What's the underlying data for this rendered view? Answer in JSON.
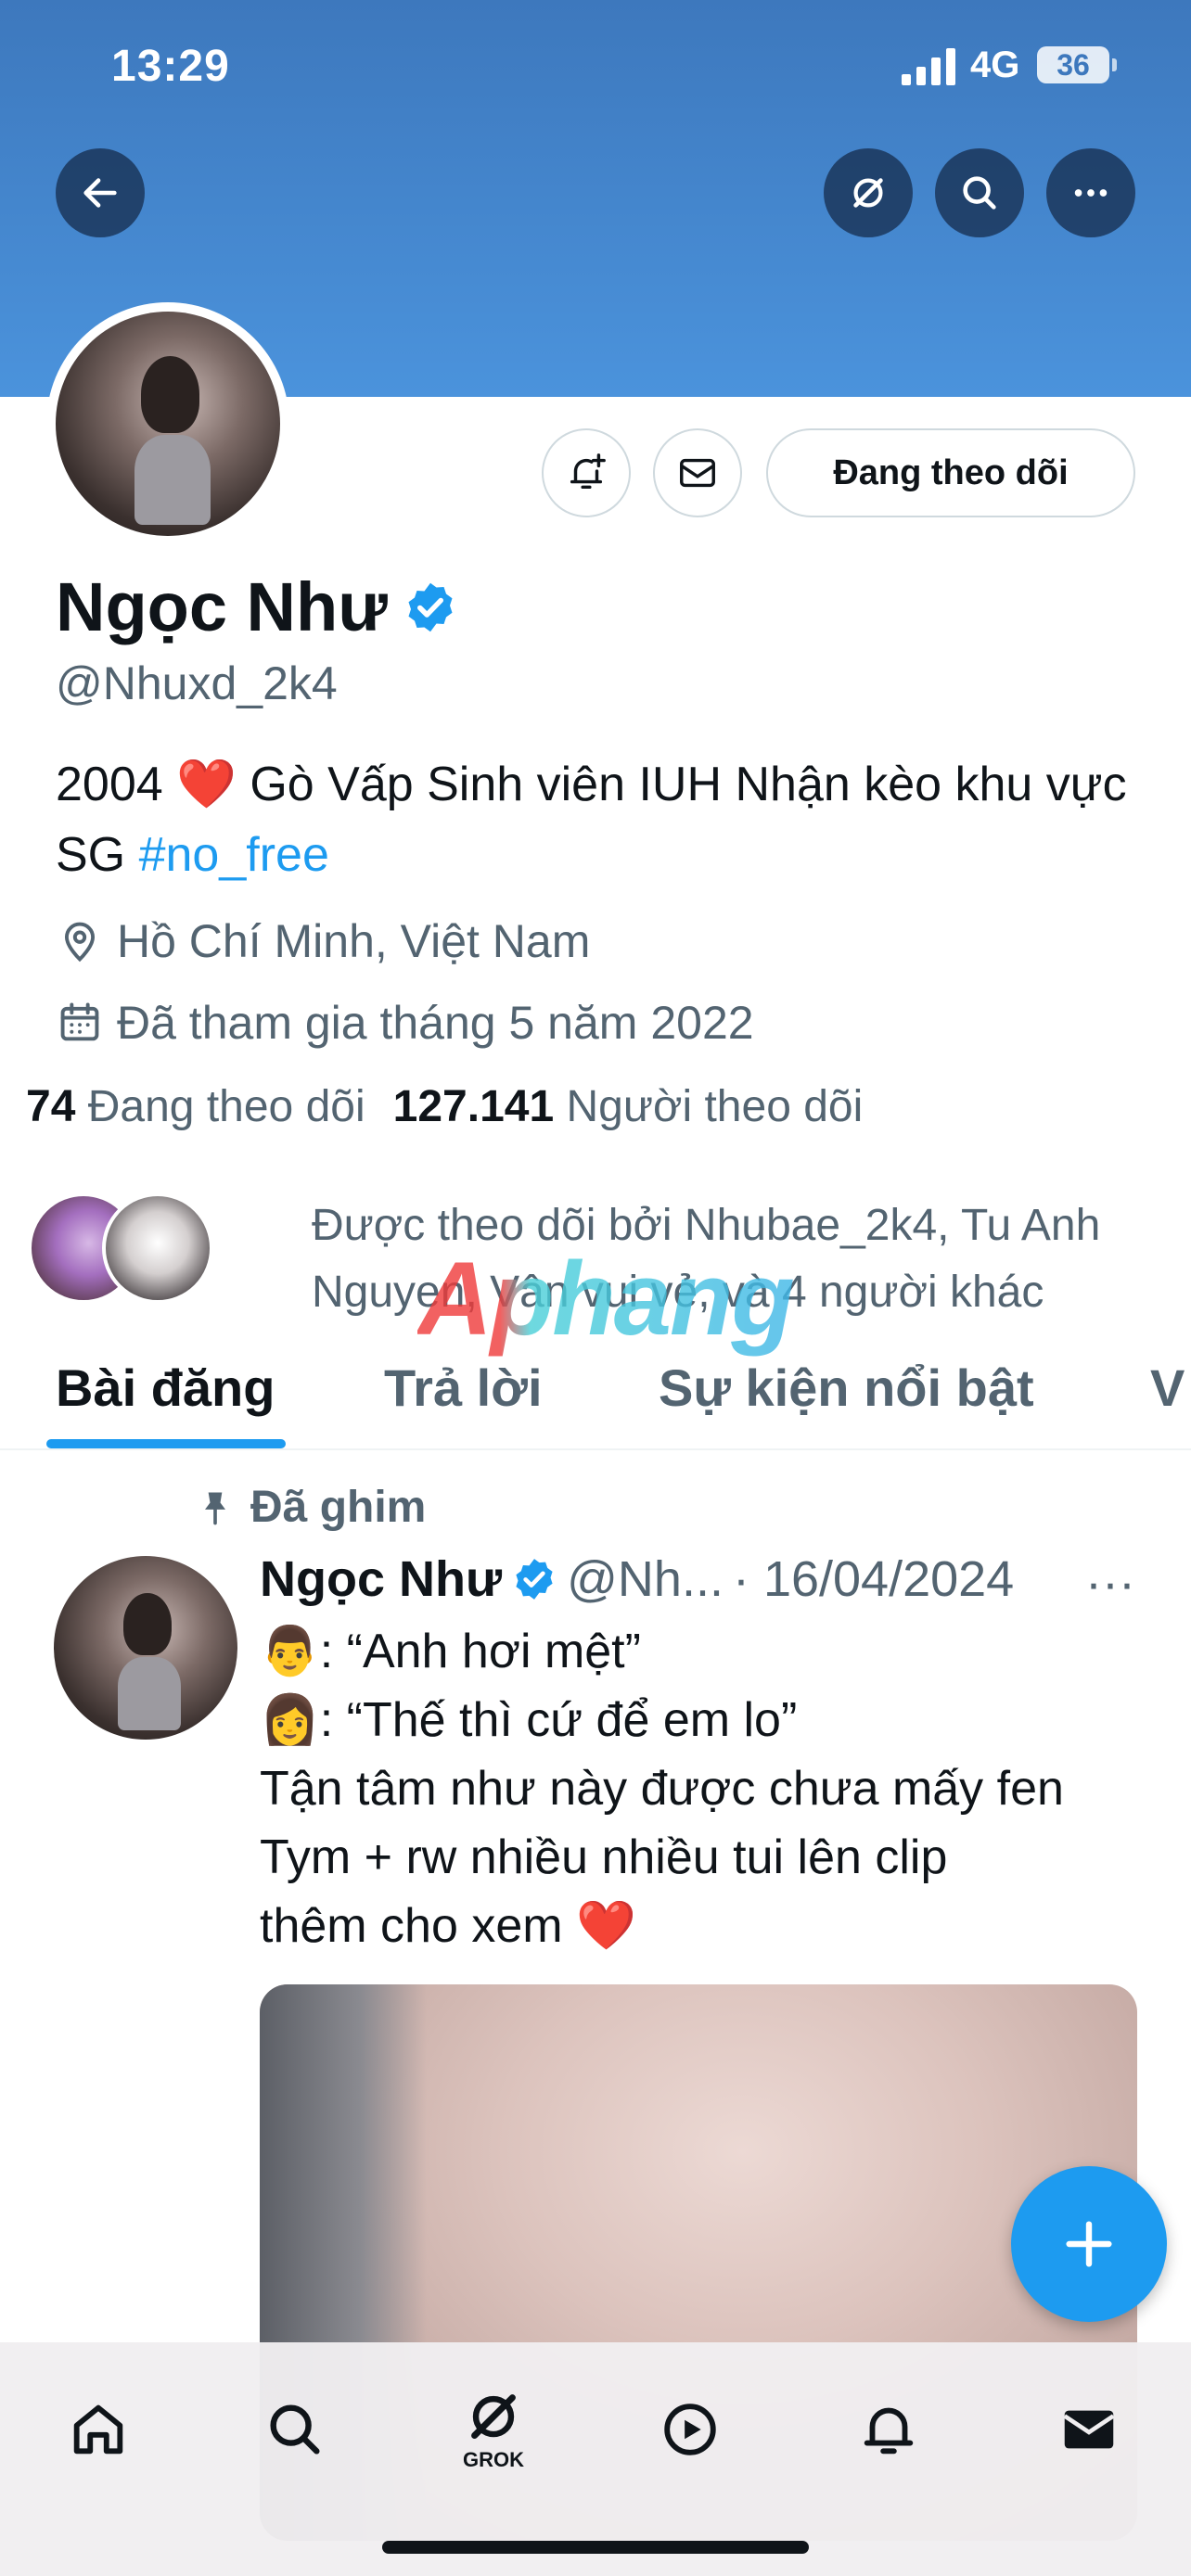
{
  "status_bar": {
    "time": "13:29",
    "network": "4G",
    "battery": "36"
  },
  "header": {
    "back_icon": "arrow-left-icon",
    "grok_icon": "grok-icon",
    "search_icon": "search-icon",
    "more_icon": "more-horizontal-icon"
  },
  "profile": {
    "name": "Ngọc Như",
    "handle": "@Nhuxd_2k4",
    "bio_text": "2004 ❤️ Gò Vấp Sinh viên IUH Nhận kèo khu vực SG ",
    "bio_hashtag": "#no_free",
    "location": "Hồ Chí Minh, Việt Nam",
    "joined": "Đã tham gia tháng 5 năm 2022",
    "following_count": "74",
    "following_label": "Đang theo dõi",
    "followers_count": "127.141",
    "followers_label": "Người theo dõi",
    "followed_by": "Được theo dõi bởi Nhubae_2k4, Tu Anh Nguyen, Vân vui vẻ, và 4 người khác",
    "follow_button": "Đang theo dõi",
    "watermark": "Aphang"
  },
  "tabs": [
    {
      "label": "Bài đăng",
      "active": true
    },
    {
      "label": "Trả lời",
      "active": false
    },
    {
      "label": "Sự kiện nổi bật",
      "active": false
    },
    {
      "label": "V",
      "active": false
    }
  ],
  "post": {
    "pinned_label": "Đã ghim",
    "author": "Ngọc Như",
    "handle": "@Nh...",
    "date": "· 16/04/2024",
    "more": "···",
    "text": "👨: “Anh hơi mệt”\n👩: “Thế thì cứ để em lo”\nTận tâm như này được chưa mấy fen\nTym + rw nhiều nhiều tui lên clip\nthêm cho xem ❤️"
  },
  "bottom_nav": {
    "items": [
      "home-icon",
      "search-icon",
      "grok-icon",
      "video-icon",
      "notifications-icon",
      "messages-icon"
    ],
    "grok_label": "GROK"
  },
  "colors": {
    "accent": "#1d9bf0",
    "banner": "#4b93dc",
    "text": "#0f1419",
    "muted": "#536471"
  }
}
